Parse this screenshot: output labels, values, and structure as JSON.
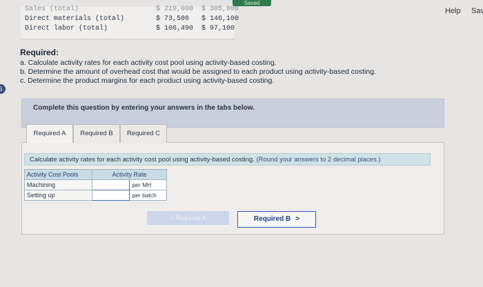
{
  "topbar": {
    "saved_label": "Saved",
    "help_label": "Help",
    "save_label": "Sav"
  },
  "side_marker": "6",
  "data_table": {
    "rows": [
      {
        "label": "Sales (total)",
        "v1": "$ 219,000",
        "v2": "$ 305,000"
      },
      {
        "label": "Direct materials (total)",
        "v1": "$  73,500",
        "v2": "$ 146,100"
      },
      {
        "label": "Direct labor (total)",
        "v1": "$ 106,490",
        "v2": "$  97,100"
      }
    ]
  },
  "required": {
    "heading": "Required:",
    "items": [
      "a. Calculate activity rates for each activity cost pool using activity-based costing.",
      "b. Determine the amount of overhead cost that would be assigned to each product using activity-based costing.",
      "c. Determine the product margins for each product using activity-based costing."
    ]
  },
  "banner": {
    "text": "Complete this question by entering your answers in the tabs below."
  },
  "tabs": [
    {
      "label": "Required A",
      "active": true
    },
    {
      "label": "Required B",
      "active": false
    },
    {
      "label": "Required C",
      "active": false
    }
  ],
  "instruction": {
    "text": "Calculate activity rates for each activity cost pool using activity-based costing.",
    "note": "(Round your answers to 2 decimal places.)"
  },
  "rate_table": {
    "headers": [
      "Activity Cost Pools",
      "Activity Rate"
    ],
    "rows": [
      {
        "pool": "Machining",
        "rate": "",
        "unit": "per MH"
      },
      {
        "pool": "Setting up",
        "rate": "",
        "unit": "per batch"
      }
    ]
  },
  "nav": {
    "prev_label": "< Required A",
    "next_label": "Required B",
    "next_arrow": ">"
  }
}
